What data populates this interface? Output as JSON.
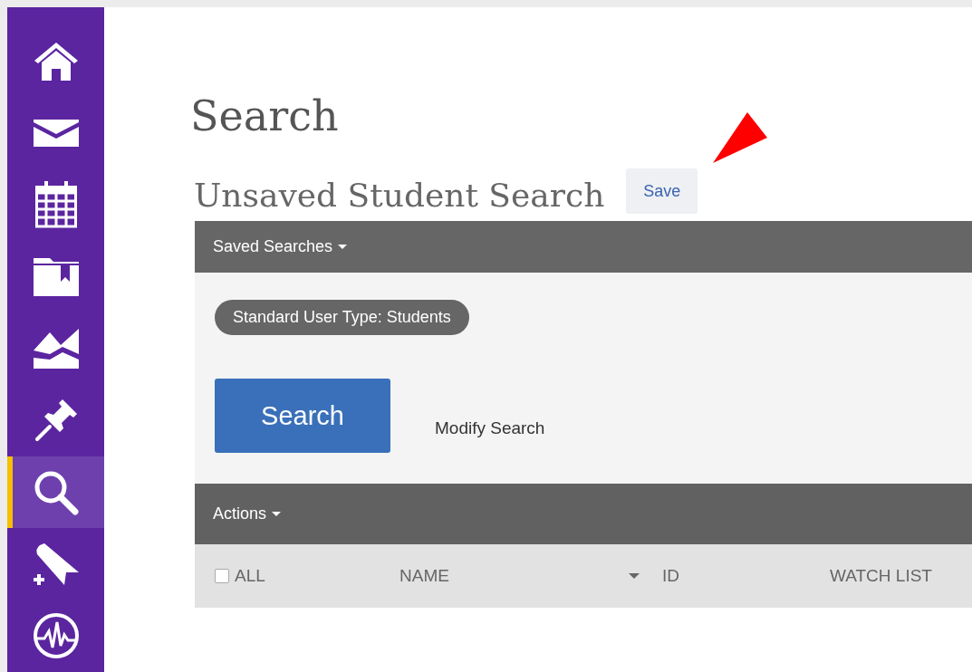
{
  "sidebar": {
    "items": [
      {
        "kind": "home",
        "selected": false
      },
      {
        "kind": "mail",
        "selected": false
      },
      {
        "kind": "calendar",
        "selected": false
      },
      {
        "kind": "folder",
        "selected": false
      },
      {
        "kind": "chart",
        "selected": false
      },
      {
        "kind": "pin",
        "selected": false
      },
      {
        "kind": "search",
        "selected": true
      },
      {
        "kind": "tag",
        "selected": false
      },
      {
        "kind": "pulse",
        "selected": false
      }
    ]
  },
  "page_title": "Search",
  "search_title": "Unsaved Student Search",
  "save_button": "Save",
  "saved_searches": "Saved Searches",
  "filters": [
    "Standard User Type: Students"
  ],
  "search_button": "Search",
  "modify_link": "Modify Search",
  "actions": "Actions",
  "table": {
    "select_all": {
      "label": "ALL",
      "checked": false
    },
    "columns": [
      {
        "label": "NAME",
        "sortable": true
      },
      {
        "label": "ID",
        "sortable": false
      },
      {
        "label": "WATCH LIST",
        "sortable": false
      }
    ]
  }
}
